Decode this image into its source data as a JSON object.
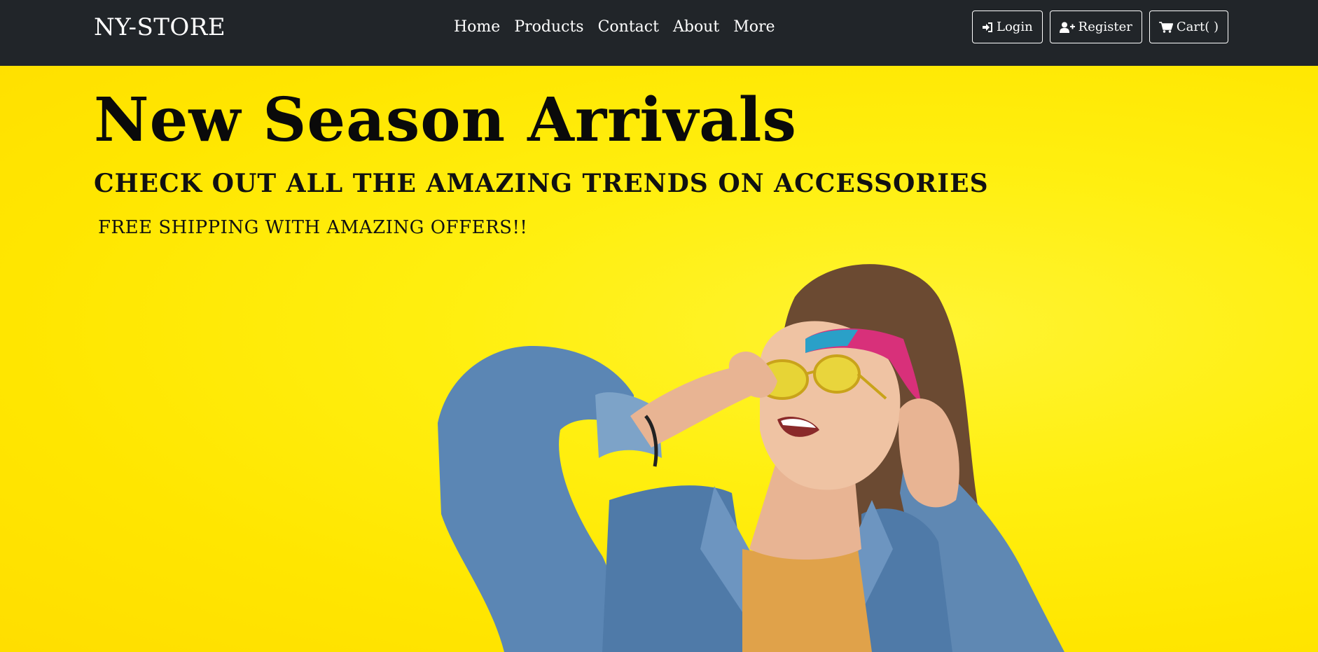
{
  "navbar": {
    "brand": "NY-STORE",
    "links": [
      {
        "label": "Home"
      },
      {
        "label": "Products"
      },
      {
        "label": "Contact"
      },
      {
        "label": "About"
      },
      {
        "label": "More"
      }
    ],
    "buttons": {
      "login": {
        "label": "Login",
        "icon": "sign-in-icon"
      },
      "register": {
        "label": "Register",
        "icon": "user-plus-icon"
      },
      "cart": {
        "label": "Cart( )",
        "icon": "cart-icon"
      }
    }
  },
  "hero": {
    "title": "New Season Arrivals",
    "subtitle": "CHECK OUT ALL THE AMAZING TRENDS ON ACCESSORIES",
    "tagline": "FREE SHIPPING WITH AMAZING OFFERS!!",
    "image": "hero-photo-woman-yellow-background"
  },
  "colors": {
    "navbar_bg": "#212529",
    "hero_bg": "#ffe800",
    "text_dark": "#0a0a0a",
    "nav_text": "#ffffff"
  }
}
